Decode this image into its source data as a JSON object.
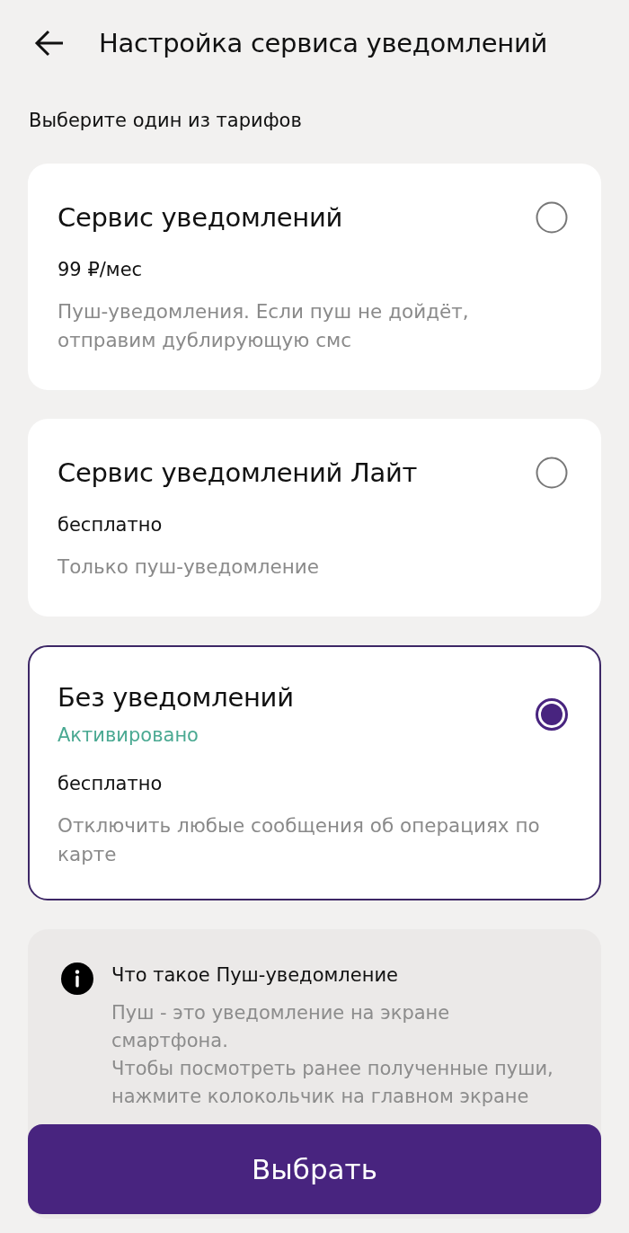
{
  "header": {
    "title": "Настройка сервиса уведомлений"
  },
  "subtitle": "Выберите один из тарифов",
  "tariffs": [
    {
      "title": "Сервис уведомлений",
      "price": "99 ₽/мес",
      "description": "Пуш-уведомления. Если пуш не дойдёт, отправим дублирующую смс",
      "selected": false
    },
    {
      "title": "Сервис уведомлений Лайт",
      "price": "бесплатно",
      "description": "Только пуш-уведомление",
      "selected": false
    },
    {
      "title": "Без уведомлений",
      "status": "Активировано",
      "price": "бесплатно",
      "description": "Отключить любые сообщения об операциях по карте",
      "selected": true
    }
  ],
  "info": {
    "title": "Что такое Пуш-уведомление",
    "paragraphs": [
      "Пуш - это уведомление на экране смартфона.",
      "Чтобы посмотреть ранее полученные пуши, нажмите колокольчик на главном экране"
    ]
  },
  "primary_button": "Выбрать"
}
